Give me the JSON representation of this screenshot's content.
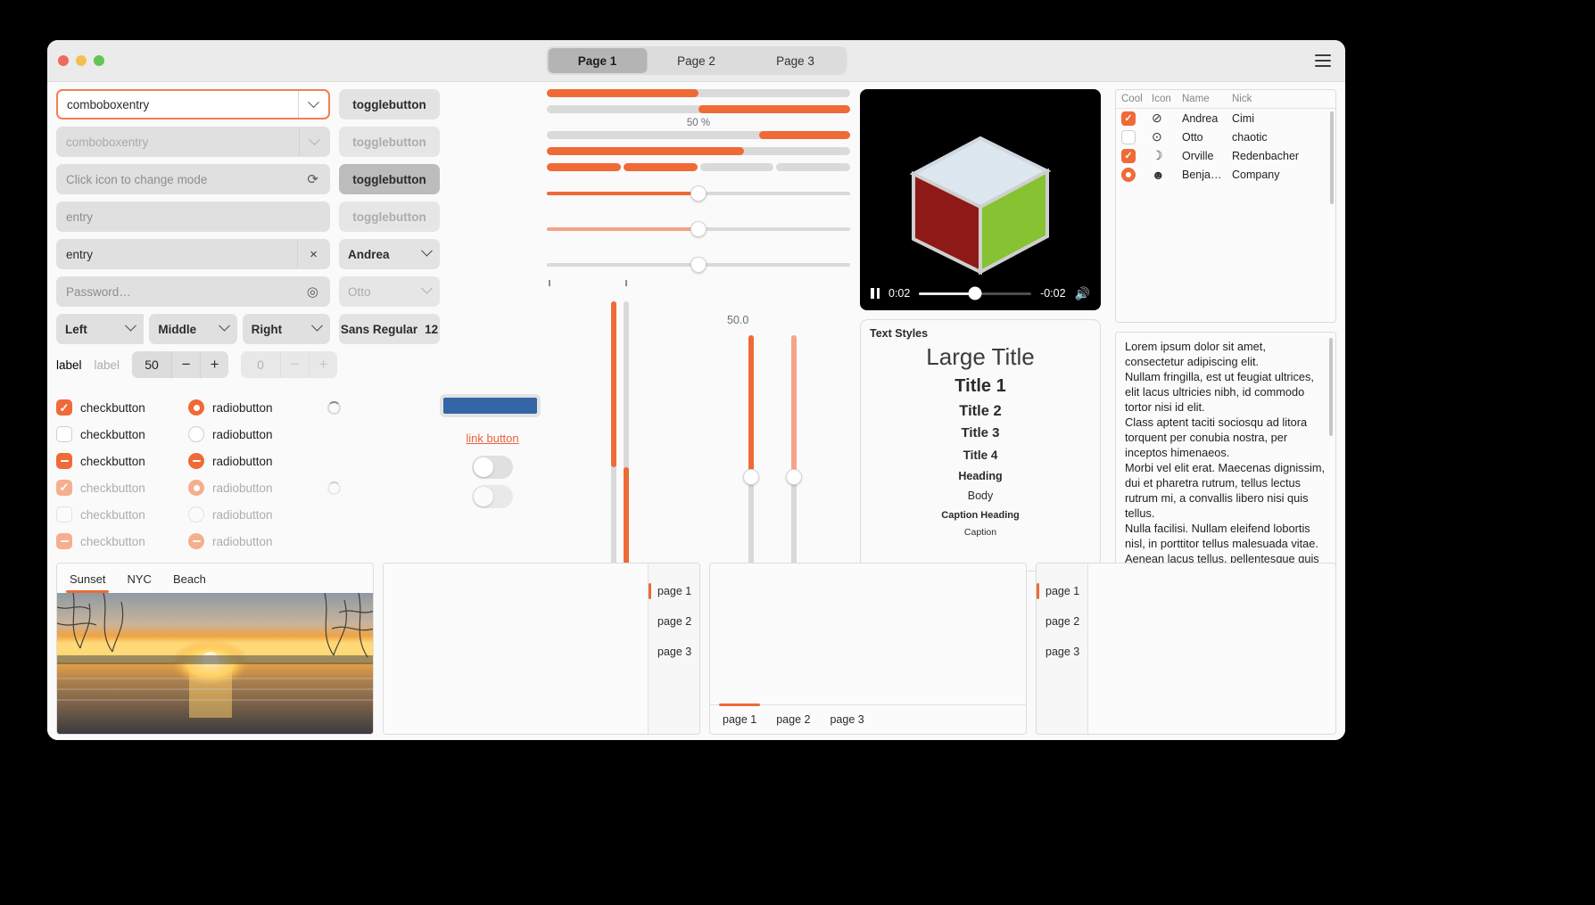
{
  "window": {
    "traffic_lights": [
      "close",
      "minimize",
      "maximize"
    ],
    "menu_icon": "hamburger-icon",
    "tabs": [
      {
        "label": "Page 1",
        "active": true
      },
      {
        "label": "Page 2",
        "active": false
      },
      {
        "label": "Page 3",
        "active": false
      }
    ]
  },
  "entries": {
    "comboboxentry_value": "comboboxentry",
    "comboboxentry_disabled": "comboboxentry",
    "icon_mode_placeholder": "Click icon to change mode",
    "entry_placeholder": "entry",
    "entry_value": "entry",
    "password_placeholder": "Password…",
    "clear_icon": "×",
    "reveal_icon": "eye-icon",
    "refresh_icon": "refresh-icon"
  },
  "togglebuttons": [
    {
      "label": "togglebutton",
      "state": "normal"
    },
    {
      "label": "togglebutton",
      "state": "disabled"
    },
    {
      "label": "togglebutton",
      "state": "active"
    },
    {
      "label": "togglebutton",
      "state": "disabled"
    }
  ],
  "dropdowns": {
    "name_active": "Andrea",
    "name_disabled": "Otto",
    "font_family": "Sans Regular",
    "font_size": "12",
    "color_hex": "#3465a4"
  },
  "alignments": [
    {
      "label": "Left"
    },
    {
      "label": "Middle"
    },
    {
      "label": "Right"
    }
  ],
  "label_row": {
    "label_enabled": "label",
    "label_disabled": "label",
    "spin_value": "50",
    "spin_minus": "−",
    "spin_plus": "+",
    "spin_disabled_value": "0",
    "spin_disabled_minus": "−",
    "spin_disabled_plus": "+"
  },
  "check_radio": {
    "check_label": "checkbutton",
    "radio_label": "radiobutton",
    "rows": [
      {
        "check": "checked",
        "radio": "checked",
        "spinner": true,
        "disabled": false
      },
      {
        "check": "unchecked",
        "radio": "unchecked",
        "spinner": false,
        "disabled": false
      },
      {
        "check": "indeterminate",
        "radio": "indeterminate",
        "spinner": false,
        "disabled": false
      },
      {
        "check": "checked",
        "radio": "checked",
        "spinner": true,
        "disabled": true
      },
      {
        "check": "unchecked",
        "radio": "unchecked",
        "spinner": false,
        "disabled": true
      },
      {
        "check": "indeterminate",
        "radio": "indeterminate",
        "spinner": false,
        "disabled": true
      }
    ]
  },
  "progress": {
    "percent_label": "50 %",
    "bars": [
      {
        "value": 50,
        "direction": "ltr"
      },
      {
        "value": 50,
        "direction": "rtl"
      },
      {
        "value": 30,
        "direction": "rtl"
      },
      {
        "value": 65,
        "direction": "ltr"
      }
    ],
    "segmented": [
      true,
      true,
      false,
      false
    ]
  },
  "scales": {
    "horizontal": [
      {
        "value": 50,
        "disabled": false,
        "marks": false
      },
      {
        "value": 50,
        "disabled": true,
        "marks": false
      },
      {
        "value": 50,
        "disabled": false,
        "marks": true
      }
    ],
    "vertical": [
      {
        "value": 50,
        "disabled": false,
        "inverted": false
      },
      {
        "value": 50,
        "disabled": false,
        "inverted": true
      },
      {
        "value": 50,
        "disabled": false,
        "label": "50.0"
      },
      {
        "value": 50,
        "disabled": true
      }
    ],
    "vertical_value_label": "50.0"
  },
  "link_button": {
    "label": "link button"
  },
  "switches": [
    {
      "state": "off",
      "disabled": false
    },
    {
      "state": "off",
      "disabled": true
    }
  ],
  "video": {
    "elapsed": "0:02",
    "remaining": "-0:02",
    "progress_percent": 50,
    "play_state": "pause-icon",
    "volume_icon": "volume-icon",
    "content": "spinning-cube"
  },
  "text_styles": {
    "frame_title": "Text Styles",
    "lines": [
      {
        "text": "Large Title",
        "class": "ts-largetitle"
      },
      {
        "text": "Title 1",
        "class": "ts-t1"
      },
      {
        "text": "Title 2",
        "class": "ts-t2"
      },
      {
        "text": "Title 3",
        "class": "ts-t3"
      },
      {
        "text": "Title 4",
        "class": "ts-t4"
      },
      {
        "text": "Heading",
        "class": "ts-heading"
      },
      {
        "text": "Body",
        "class": "ts-body"
      },
      {
        "text": "Caption Heading",
        "class": "ts-caph"
      },
      {
        "text": "Caption",
        "class": "ts-cap"
      }
    ]
  },
  "list_view": {
    "columns": [
      "Cool",
      "Icon",
      "Name",
      "Nick"
    ],
    "rows": [
      {
        "cool": "checked",
        "icon": "check-circle-icon",
        "icon_glyph": "⊘",
        "name": "Andrea",
        "nick": "Cimi"
      },
      {
        "cool": "unchecked",
        "icon": "warning-circle-icon",
        "icon_glyph": "!",
        "name": "Otto",
        "nick": "chaotic"
      },
      {
        "cool": "checked",
        "icon": "moon-icon",
        "icon_glyph": "☾",
        "name": "Orville",
        "nick": "Redenbacher"
      },
      {
        "cool": "radio",
        "icon": "face-icon",
        "icon_glyph": "☻",
        "name": "Benja…",
        "nick": "Company"
      }
    ]
  },
  "text_view": {
    "paragraphs": [
      "Lorem ipsum dolor sit amet, consectetur adipiscing elit.",
      "Nullam fringilla, est ut feugiat ultrices, elit lacus ultricies nibh, id commodo tortor nisi id elit.",
      "Class aptent taciti sociosqu ad litora torquent per conubia nostra, per inceptos himenaeos.",
      "Morbi vel elit erat. Maecenas dignissim, dui et pharetra rutrum, tellus lectus rutrum mi, a convallis libero nisi quis tellus.",
      "Nulla facilisi. Nullam eleifend lobortis nisl, in porttitor tellus malesuada vitae. Aenean lacus tellus, pellentesque quis molestie quis, fringilla in arcu."
    ]
  },
  "bottom": {
    "picture_tabs": [
      {
        "label": "Sunset",
        "active": true
      },
      {
        "label": "NYC",
        "active": false
      },
      {
        "label": "Beach",
        "active": false
      }
    ],
    "notebook2_tabs": [
      {
        "label": "page 1",
        "active": true
      },
      {
        "label": "page 2",
        "active": false
      },
      {
        "label": "page 3",
        "active": false
      }
    ],
    "notebook3_tabs": [
      {
        "label": "page 1",
        "active": true
      },
      {
        "label": "page 2",
        "active": false
      },
      {
        "label": "page 3",
        "active": false
      }
    ],
    "notebook4_tabs": [
      {
        "label": "page 1",
        "active": true
      },
      {
        "label": "page 2",
        "active": false
      },
      {
        "label": "page 3",
        "active": false
      }
    ]
  },
  "colors": {
    "accent": "#ef6a37",
    "accent_dim": "#f5a486",
    "blue": "#3465a4",
    "bg": "#fafafa",
    "control": "#e0e0e0"
  }
}
